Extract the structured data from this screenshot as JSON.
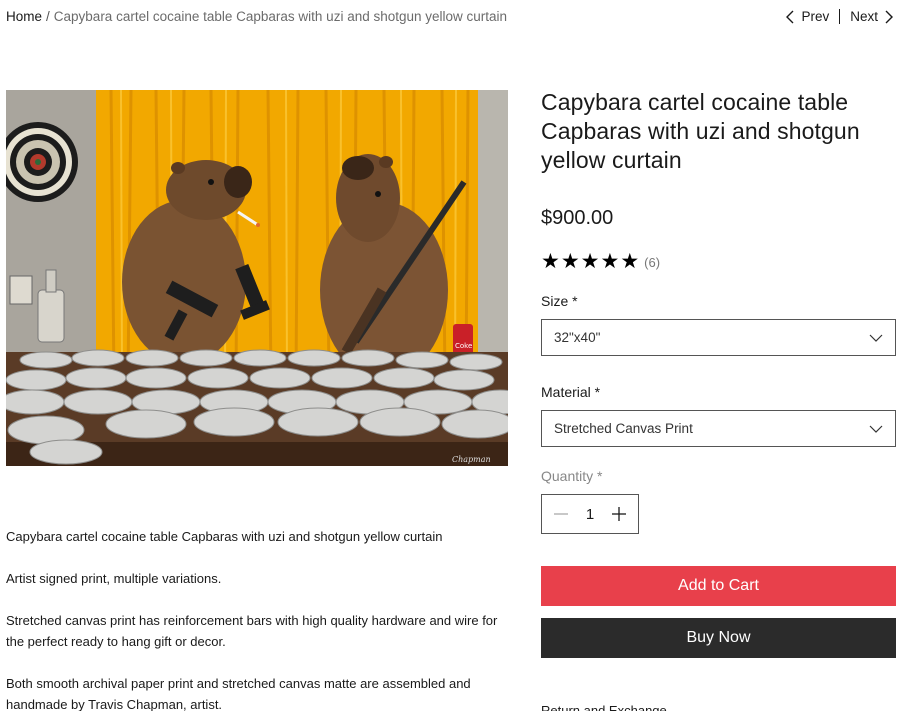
{
  "breadcrumb": {
    "home": "Home",
    "separator": "/",
    "current": "Capybara cartel cocaine table Capbaras with uzi and shotgun yellow curtain"
  },
  "pager": {
    "prev": "Prev",
    "next": "Next"
  },
  "product": {
    "title": "Capybara cartel cocaine table Capbaras with uzi and shotgun yellow curtain",
    "price": "$900.00",
    "rating": {
      "stars": 5,
      "count": "(6)"
    },
    "image": {
      "can_label": "Coke",
      "signature": "Chapman"
    }
  },
  "options": {
    "size": {
      "label": "Size *",
      "value": "32\"x40\""
    },
    "material": {
      "label": "Material *",
      "value": "Stretched Canvas Print"
    }
  },
  "quantity": {
    "label": "Quantity *",
    "value": "1"
  },
  "buttons": {
    "add_to_cart": "Add to Cart",
    "buy_now": "Buy Now"
  },
  "description": {
    "paragraphs": [
      "Capybara cartel cocaine table Capbaras  with uzi and shotgun yellow curtain",
      "Artist signed print, multiple variations.",
      "Stretched canvas print has reinforcement bars with high quality hardware and wire for the perfect ready to hang gift or decor.",
      "Both smooth archival paper print and stretched canvas matte are assembled and handmade by Travis Chapman, artist."
    ]
  },
  "section_cut": "Return and Exchange",
  "colors": {
    "accent_cart": "#e8404b",
    "buy_now": "#2b2b2b",
    "curtain": "#f2a800"
  }
}
